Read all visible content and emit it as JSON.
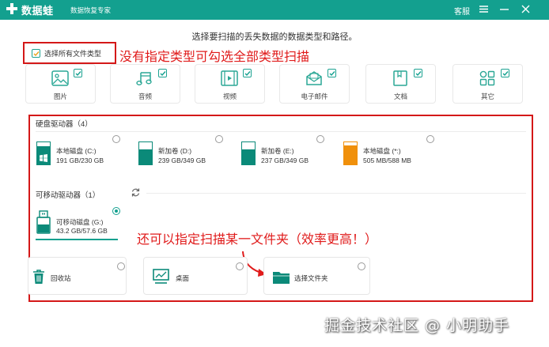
{
  "app": {
    "name": "数据蛙",
    "subtitle": "数据恢复专家",
    "service": "客服"
  },
  "colors": {
    "accent": "#13a08f",
    "annotation": "#e01b1b",
    "drive_orange": "#f0900b",
    "drive_teal": "#0b8a79"
  },
  "instruction": "选择要扫描的丢失数据的数据类型和路径。",
  "select_all": {
    "label": "选择所有文件类型",
    "checked": true
  },
  "annotations": {
    "select_all_tip": "没有指定类型可勾选全部类型扫描",
    "folder_tip": "还可以指定扫描某一文件夹（效率更高！）"
  },
  "file_types": [
    {
      "label": "图片",
      "icon": "image-icon",
      "checked": true
    },
    {
      "label": "音频",
      "icon": "music-icon",
      "checked": true
    },
    {
      "label": "视频",
      "icon": "video-icon",
      "checked": true
    },
    {
      "label": "电子邮件",
      "icon": "mail-icon",
      "checked": true
    },
    {
      "label": "文档",
      "icon": "document-icon",
      "checked": true
    },
    {
      "label": "其它",
      "icon": "apps-icon",
      "checked": true
    }
  ],
  "hard_drives": {
    "title": "硬盘驱动器（4）",
    "items": [
      {
        "name": "本地磁盘 (C:)",
        "size": "191 GB/230 GB",
        "fill": 0.83,
        "color": "#0b8a79",
        "windows_logo": true,
        "selected": false
      },
      {
        "name": "新加卷 (D:)",
        "size": "239 GB/349 GB",
        "fill": 0.68,
        "color": "#0b8a79",
        "windows_logo": false,
        "selected": false
      },
      {
        "name": "新加卷 (E:)",
        "size": "237 GB/349 GB",
        "fill": 0.68,
        "color": "#0b8a79",
        "windows_logo": false,
        "selected": false
      },
      {
        "name": "本地磁盘 (*:)",
        "size": "505 MB/588 MB",
        "fill": 0.86,
        "color": "#f0900b",
        "windows_logo": false,
        "selected": false
      }
    ]
  },
  "removable": {
    "title": "可移动驱动器（1）",
    "items": [
      {
        "name": "可移动磁盘 (G:)",
        "size": "43.2 GB/57.6 GB",
        "selected": true
      }
    ]
  },
  "locations": [
    {
      "label": "回收站",
      "icon": "recycle-bin-icon",
      "selected": false
    },
    {
      "label": "桌面",
      "icon": "desktop-icon",
      "selected": false
    },
    {
      "label": "选择文件夹",
      "icon": "folder-icon",
      "selected": false
    }
  ],
  "watermark": "掘金技术社区 @ 小明助手"
}
